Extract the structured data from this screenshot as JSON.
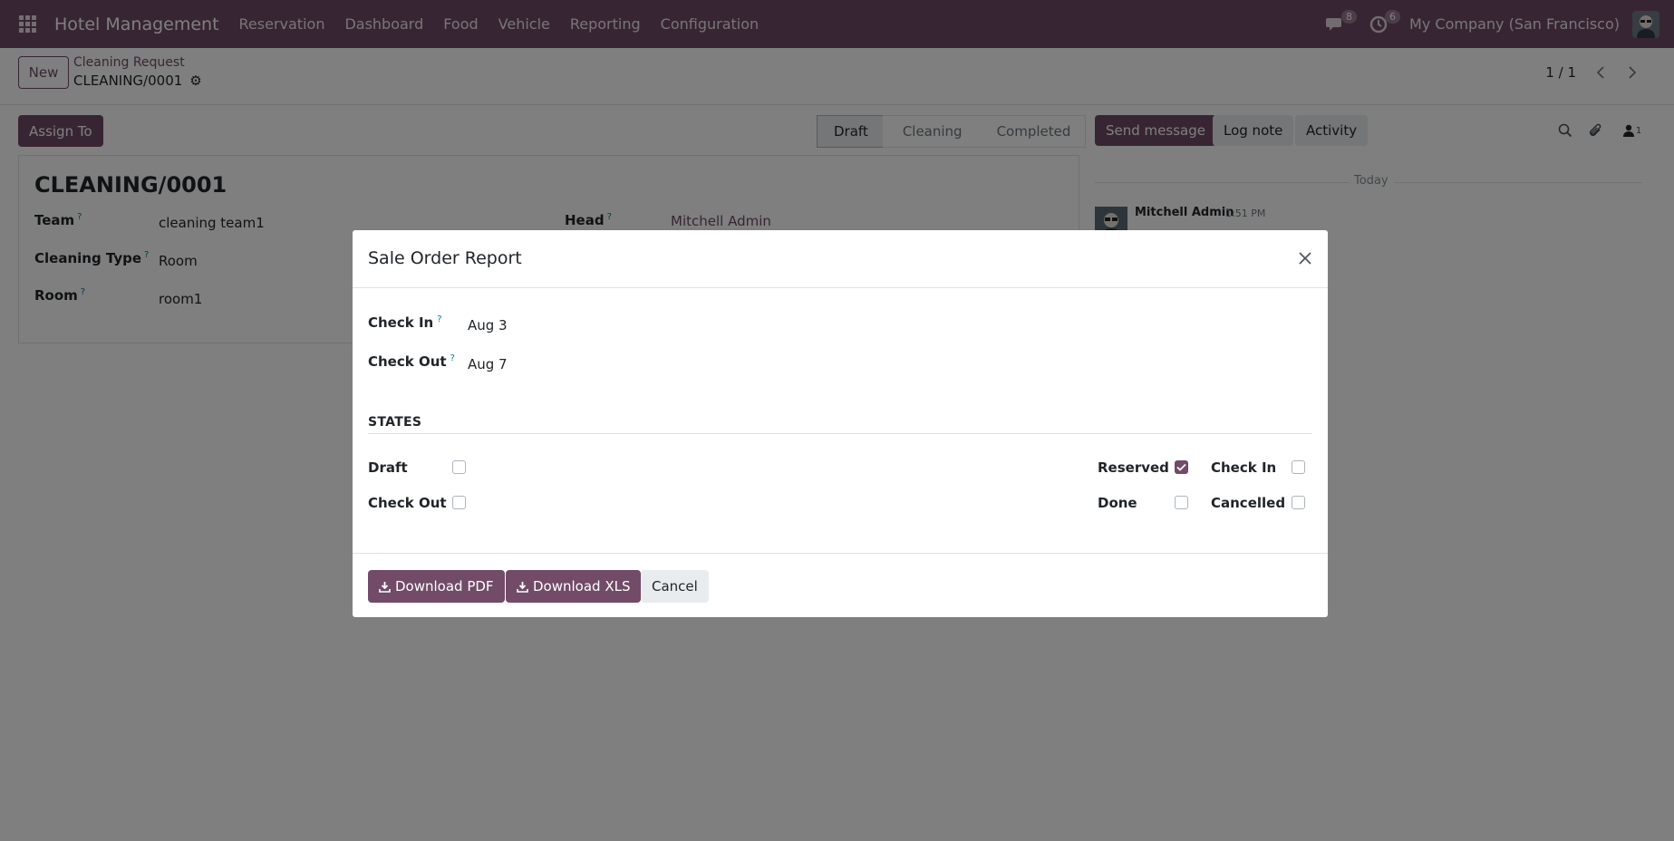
{
  "navbar": {
    "brand": "Hotel Management",
    "menu": [
      "Reservation",
      "Dashboard",
      "Food",
      "Vehicle",
      "Reporting",
      "Configuration"
    ],
    "messages_count": "8",
    "activities_count": "6",
    "company": "My Company (San Francisco)"
  },
  "control": {
    "new_label": "New",
    "breadcrumb_parent": "Cleaning Request",
    "breadcrumb_current": "CLEANING/0001",
    "pager": "1 / 1"
  },
  "form": {
    "assign_label": "Assign To",
    "stages": [
      "Draft",
      "Cleaning",
      "Completed"
    ],
    "active_stage": "Draft",
    "title": "CLEANING/0001",
    "fields": {
      "team_label": "Team",
      "team_value": "cleaning team1",
      "head_label": "Head",
      "head_value": "Mitchell Admin",
      "cleaning_type_label": "Cleaning Type",
      "cleaning_type_value": "Room",
      "room_label": "Room",
      "room_value": "room1"
    },
    "help_marker": "?"
  },
  "chatter": {
    "send_message": "Send message",
    "log_note": "Log note",
    "activity": "Activity",
    "followers_count": "1",
    "today": "Today",
    "author": "Mitchell Admin",
    "time": "1:51 PM"
  },
  "modal": {
    "title": "Sale Order Report",
    "check_in_label": "Check In",
    "check_in_value": "Aug 3",
    "check_out_label": "Check Out",
    "check_out_value": "Aug 7",
    "states_title": "STATES",
    "states": [
      {
        "label": "Draft",
        "checked": false
      },
      {
        "label": "Check Out",
        "checked": false
      },
      {
        "label": "Reserved",
        "checked": true
      },
      {
        "label": "Done",
        "checked": false
      },
      {
        "label": "Check In",
        "checked": false
      },
      {
        "label": "Cancelled",
        "checked": false
      }
    ],
    "download_pdf": "Download PDF",
    "download_xls": "Download XLS",
    "cancel": "Cancel"
  },
  "colors": {
    "brand": "#714b67",
    "link": "#017e84"
  }
}
